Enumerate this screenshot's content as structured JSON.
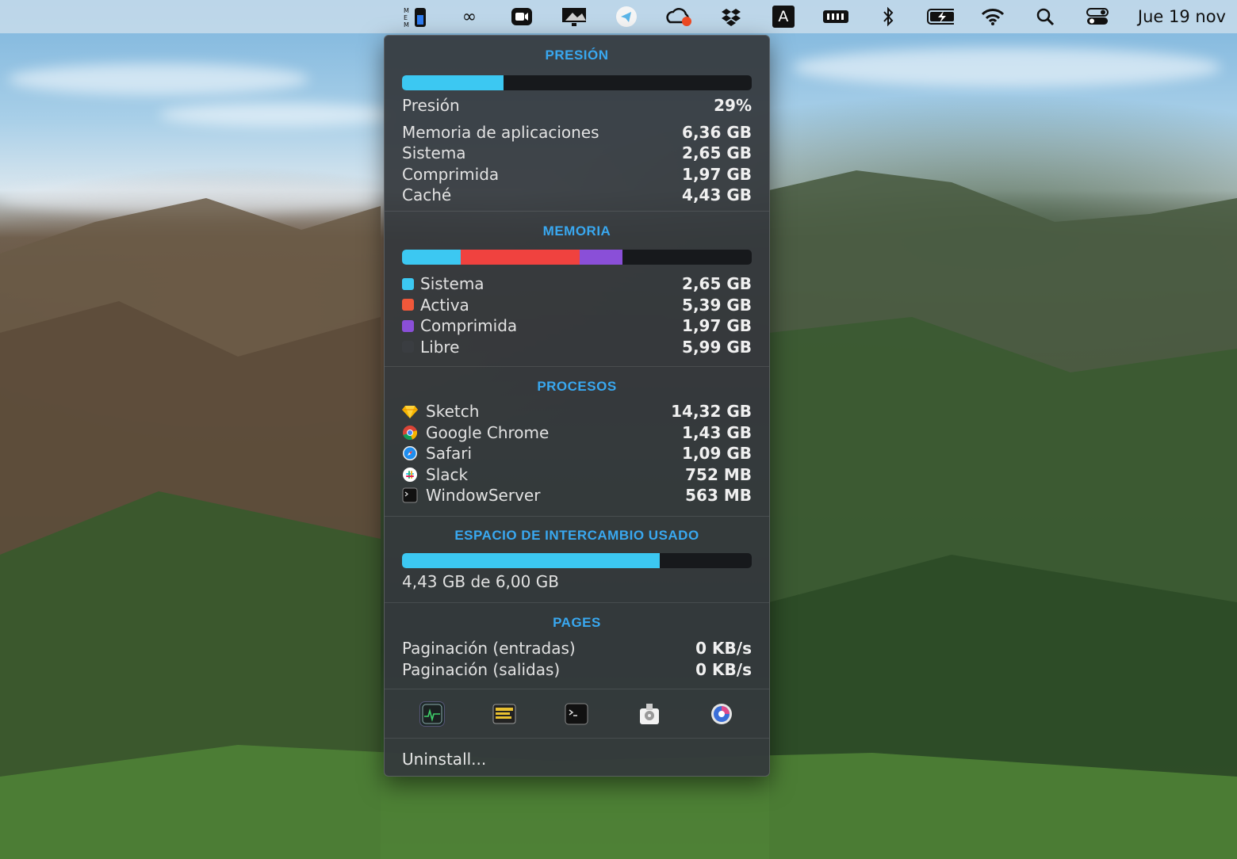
{
  "menubar": {
    "date": "Jue 19 nov",
    "icons": [
      "memory-meter-icon",
      "infinity-icon",
      "zoom-icon",
      "display-icon",
      "telegram-icon",
      "cloud-sync-icon",
      "dropbox-icon",
      "text-input-a-icon",
      "memory-chip-icon",
      "bluetooth-icon",
      "battery-charging-icon",
      "wifi-icon",
      "search-icon",
      "control-center-icon"
    ],
    "ime_letter": "A"
  },
  "pressure": {
    "title": "PRESIÓN",
    "bar_fraction": 0.29,
    "bar_color": "#3cc8f2",
    "rows": [
      {
        "label": "Presión",
        "value": "29%"
      },
      {
        "label": "Memoria de aplicaciones",
        "value": "6,36 GB"
      },
      {
        "label": "Sistema",
        "value": "2,65 GB"
      },
      {
        "label": "Comprimida",
        "value": "1,97 GB"
      },
      {
        "label": "Caché",
        "value": "4,43 GB"
      }
    ]
  },
  "memory": {
    "title": "MEMORIA",
    "bar_segments": [
      {
        "fraction": 0.167,
        "color": "#3cc8f2"
      },
      {
        "fraction": 0.34,
        "color": "#f0423f"
      },
      {
        "fraction": 0.124,
        "color": "#8a4fd8"
      }
    ],
    "rows": [
      {
        "label": "Sistema",
        "value": "2,65 GB",
        "color": "#3cc8f2"
      },
      {
        "label": "Activa",
        "value": "5,39 GB",
        "color": "#f0583a"
      },
      {
        "label": "Comprimida",
        "value": "1,97 GB",
        "color": "#8a4fd8"
      },
      {
        "label": "Libre",
        "value": "5,99 GB",
        "color": "#3a3d41"
      }
    ]
  },
  "processes": {
    "title": "PROCESOS",
    "rows": [
      {
        "label": "Sketch",
        "value": "14,32 GB",
        "icon": "sketch-icon"
      },
      {
        "label": "Google Chrome",
        "value": "1,43 GB",
        "icon": "chrome-icon"
      },
      {
        "label": "Safari",
        "value": "1,09 GB",
        "icon": "safari-icon"
      },
      {
        "label": "Slack",
        "value": "752 MB",
        "icon": "slack-icon"
      },
      {
        "label": "WindowServer",
        "value": "563 MB",
        "icon": "terminal-icon"
      }
    ]
  },
  "swap": {
    "title": "ESPACIO DE INTERCAMBIO USADO",
    "bar_fraction": 0.738,
    "bar_color": "#3cc8f2",
    "text": "4,43 GB de 6,00 GB"
  },
  "pages": {
    "title": "PAGES",
    "rows": [
      {
        "label": "Paginación (entradas)",
        "value": "0 KB/s"
      },
      {
        "label": "Paginación (salidas)",
        "value": "0 KB/s"
      }
    ]
  },
  "tools": [
    "activity-monitor-icon",
    "console-icon",
    "terminal-icon",
    "disk-utility-icon",
    "system-information-icon"
  ],
  "footer": {
    "uninstall": "Uninstall..."
  }
}
